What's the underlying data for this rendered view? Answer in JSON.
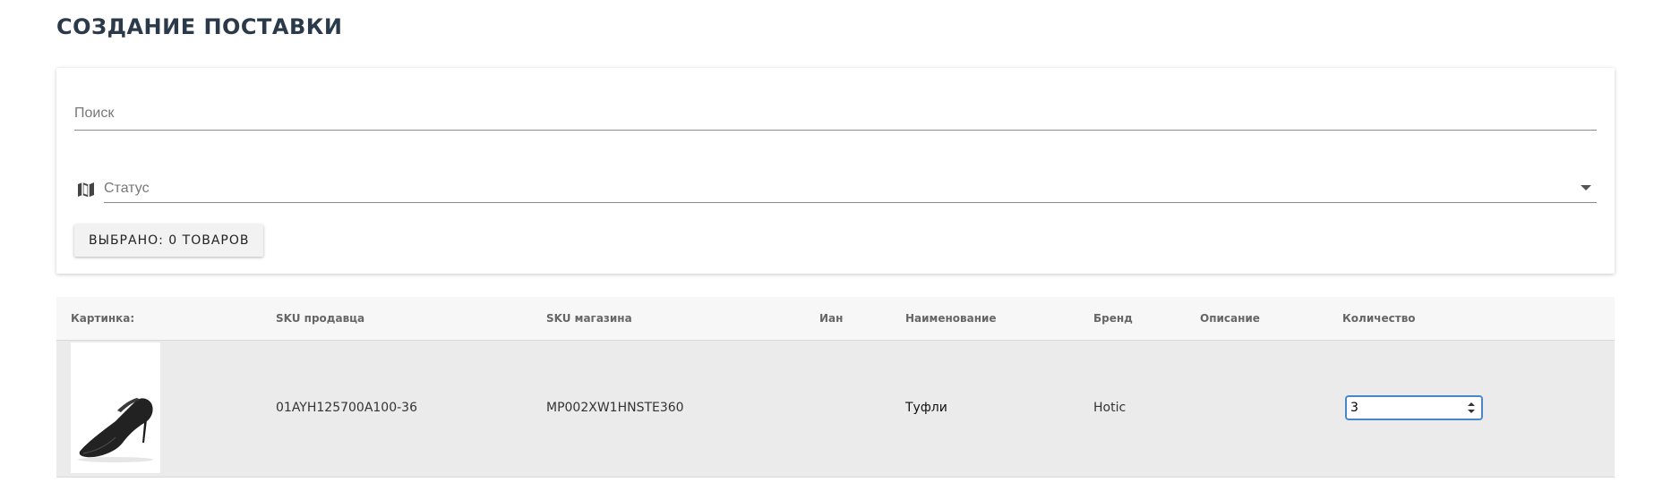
{
  "page": {
    "title": "СОЗДАНИЕ ПОСТАВКИ"
  },
  "filters": {
    "search_placeholder": "Поиск",
    "status_placeholder": "Статус",
    "status_icon": "map-icon",
    "selected_button_label": "ВЫБРАНО: 0 ТОВАРОВ"
  },
  "table": {
    "columns": [
      "Картинка:",
      "SKU продавца",
      "SKU магазина",
      "Иан",
      "Наименование",
      "Бренд",
      "Описание",
      "Количество"
    ],
    "rows": [
      {
        "image": "product-image-black-high-heel-shoe",
        "seller_sku": "01AYH125700A100-36",
        "store_sku": "MP002XW1HNSTE360",
        "ian": "",
        "name": "Туфли",
        "brand": "Hotic",
        "description": "",
        "quantity": "3"
      }
    ]
  },
  "colors": {
    "title": "#2b3a4a",
    "row_background": "#ebebeb",
    "header_background": "#f7f7f7",
    "input_focus_border": "#4a87c8"
  }
}
